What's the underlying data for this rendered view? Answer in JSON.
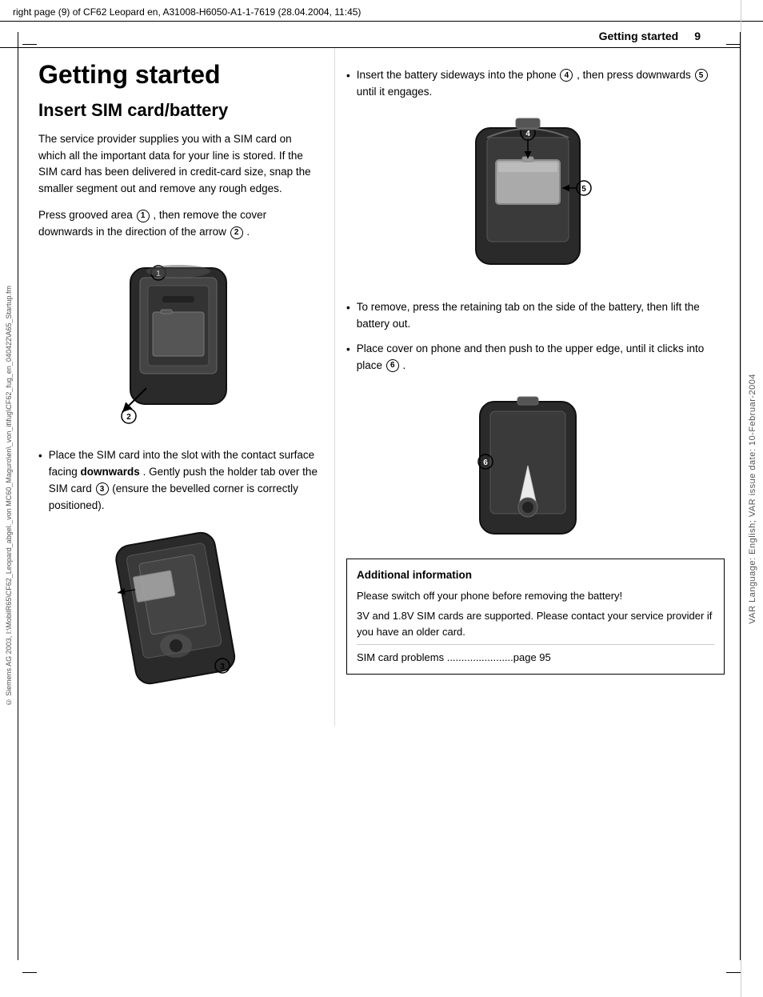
{
  "meta": {
    "top_label": "right page (9) of CF62 Leopard en, A31008-H6050-A1-1-7619 (28.04.2004, 11:45)",
    "right_sidebar": "VAR Language: English; VAR issue date: 10-Februar-2004",
    "left_sidebar": "© Siemens AG 2003, I:\\MobilR65\\CF62_Leopard_abgel._von MC60_Maguro\\en\\_von_it\\fug\\CF62_fug_en_040422\\A65_Startup.fm",
    "header_title": "Getting started",
    "header_page": "9"
  },
  "page": {
    "heading": "Getting started",
    "section_heading": "Insert SIM card/battery",
    "intro_paragraph1": "The service provider supplies you with a SIM card on which all the important data for your line is stored. If the SIM card has been delivered in credit-card size, snap the smaller segment out and remove any rough edges.",
    "intro_paragraph2": "Press grooved area",
    "intro_paragraph2_circle1": "1",
    "intro_paragraph2_rest": ", then remove the cover downwards in the direction of the arrow",
    "intro_paragraph2_circle2": "2",
    "intro_paragraph2_end": ".",
    "bullet1_text": "Place the SIM card into the slot with the contact surface facing",
    "bullet1_bold": "downwards",
    "bullet1_rest": ". Gently push the holder tab over the SIM card",
    "bullet1_circle": "3",
    "bullet1_end": " (ensure the bevelled corner is correctly positioned).",
    "right_bullet1_text": "Insert the battery sideways into the phone",
    "right_bullet1_circle4": "4",
    "right_bullet1_rest": ", then press downwards",
    "right_bullet1_circle5": "5",
    "right_bullet1_end": " until it engages.",
    "right_bullet2_text": "To remove, press the retaining tab on the side of the battery, then lift the battery out.",
    "right_bullet3_text": "Place cover on phone and then push to the upper edge, until it clicks into place",
    "right_bullet3_circle": "6",
    "right_bullet3_end": ".",
    "info_box_title": "Additional information",
    "info_line1": "Please switch off your phone before removing the battery!",
    "info_line2": "3V and 1.8V SIM cards are supported. Please contact your service provider if you have an older card.",
    "info_line3": "SIM card problems .......................page 95"
  }
}
